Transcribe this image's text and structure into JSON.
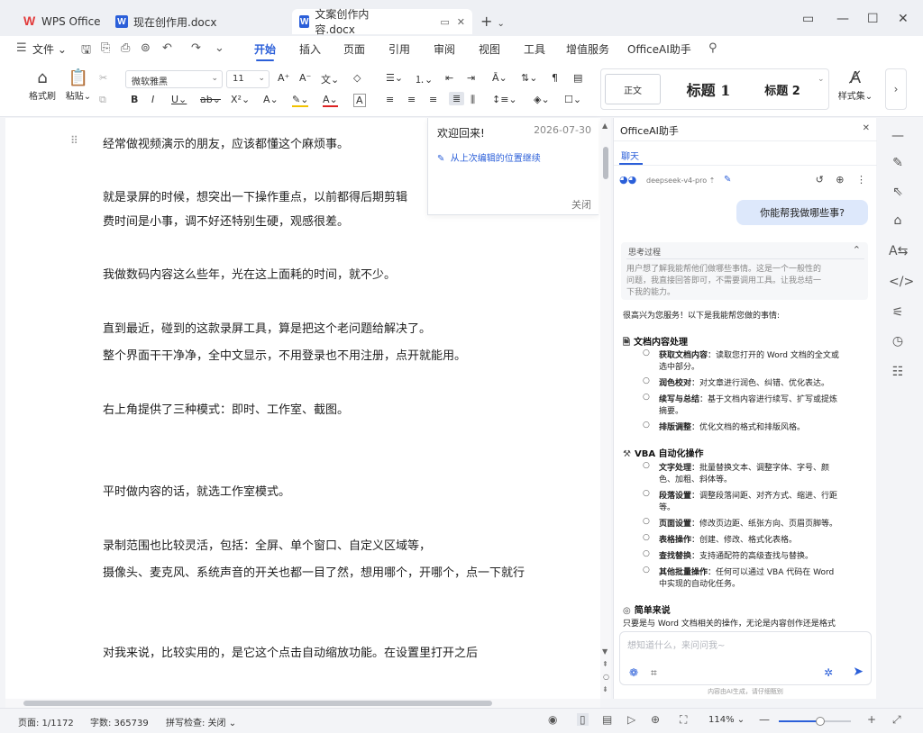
{
  "titlebar": {
    "app_name": "WPS Office",
    "tabs": [
      {
        "label": "现在创作用.docx"
      },
      {
        "label": "文案创作内容.docx"
      }
    ]
  },
  "menu": {
    "file_label": "文件",
    "items": [
      "开始",
      "插入",
      "页面",
      "引用",
      "审阅",
      "视图",
      "工具",
      "增值服务",
      "OfficeAI助手"
    ],
    "active": "开始"
  },
  "ribbon": {
    "format_painter": "格式刷",
    "paste": "粘贴",
    "font_name": "微软雅黑",
    "font_size": "11",
    "styles": {
      "normal": "正文",
      "h1": "标题 1",
      "h2": "标题 2",
      "style_set": "样式集"
    }
  },
  "document": {
    "paragraphs": [
      "经常做视频演示的朋友，应该都懂这个麻烦事。",
      "就是录屏的时候，想突出一下操作重点，以前都得后期剪辑",
      "费时间是小事，调不好还特别生硬，观感很差。",
      "我做数码内容这么些年，光在这上面耗的时间，就不少。",
      "直到最近，碰到的这款录屏工具，算是把这个老问题给解决了。",
      "整个界面干干净净，全中文显示，不用登录也不用注册，点开就能用。",
      "右上角提供了三种模式：即时、工作室、截图。",
      "平时做内容的话，就选工作室模式。",
      "录制范围也比较灵活，包括：全屏、单个窗口、自定义区域等，",
      "摄像头、麦克风、系统声音的开关也都一目了然，想用哪个，开哪个，点一下就行",
      "对我来说，比较实用的，是它这个点击自动缩放功能。在设置里打开之后"
    ]
  },
  "welcome": {
    "title": "欢迎回来!",
    "date": "2026-07-30",
    "link": "从上次编辑的位置继续",
    "close": "关闭"
  },
  "ai_panel": {
    "title": "OfficeAI助手",
    "tab": "聊天",
    "model": "deepseek-v4-pro",
    "user_message": "你能帮我做哪些事?",
    "thinking": {
      "title": "思考过程",
      "lines": [
        "用户想了解我能帮他们做哪些事情。这是一个一般性的",
        "问题，我直接回答即可，不需要调用工具。让我总结一",
        "下我的能力。"
      ]
    },
    "intro": "很高兴为您服务！以下是我能帮您做的事情:",
    "sections": [
      {
        "title": "文档内容处理",
        "items": [
          {
            "bold": "获取文档内容",
            "lines": [
              "：读取您打开的 Word 文档的全文或",
              "选中部分。"
            ]
          },
          {
            "bold": "润色校对",
            "lines": [
              "：对文章进行润色、纠错、优化表达。"
            ]
          },
          {
            "bold": "续写与总结",
            "lines": [
              "：基于文档内容进行续写、扩写或提炼",
              "摘要。"
            ]
          },
          {
            "bold": "排版调整",
            "lines": [
              "：优化文档的格式和排版风格。"
            ]
          }
        ]
      },
      {
        "title": "VBA 自动化操作",
        "items": [
          {
            "bold": "文字处理",
            "lines": [
              "：批量替换文本、调整字体、字号、颜",
              "色、加粗、斜体等。"
            ]
          },
          {
            "bold": "段落设置",
            "lines": [
              "：调整段落间距、对齐方式、缩进、行距",
              "等。"
            ]
          },
          {
            "bold": "页面设置",
            "lines": [
              "：修改页边距、纸张方向、页眉页脚等。"
            ]
          },
          {
            "bold": "表格操作",
            "lines": [
              "：创建、修改、格式化表格。"
            ]
          },
          {
            "bold": "查找替换",
            "lines": [
              "：支持通配符的高级查找与替换。"
            ]
          },
          {
            "bold": "其他批量操作",
            "lines": [
              "：任何可以通过 VBA 代码在 Word",
              "中实现的自动化任务。"
            ]
          }
        ]
      }
    ],
    "simple_title": "简单来说",
    "simple_text": "只要是与 Word 文档相关的操作，无论是内容创作还是格式",
    "input_placeholder": "想知道什么，来问问我~",
    "footnote": "内容由AI生成，请仔细甄别"
  },
  "status": {
    "page": "页面: 1/1172",
    "words": "字数: 365739",
    "spell": "拼写检查: 关闭",
    "zoom": "114%"
  },
  "colors": {
    "accent": "#2b5fd9",
    "logo_red": "#e23b3b"
  }
}
